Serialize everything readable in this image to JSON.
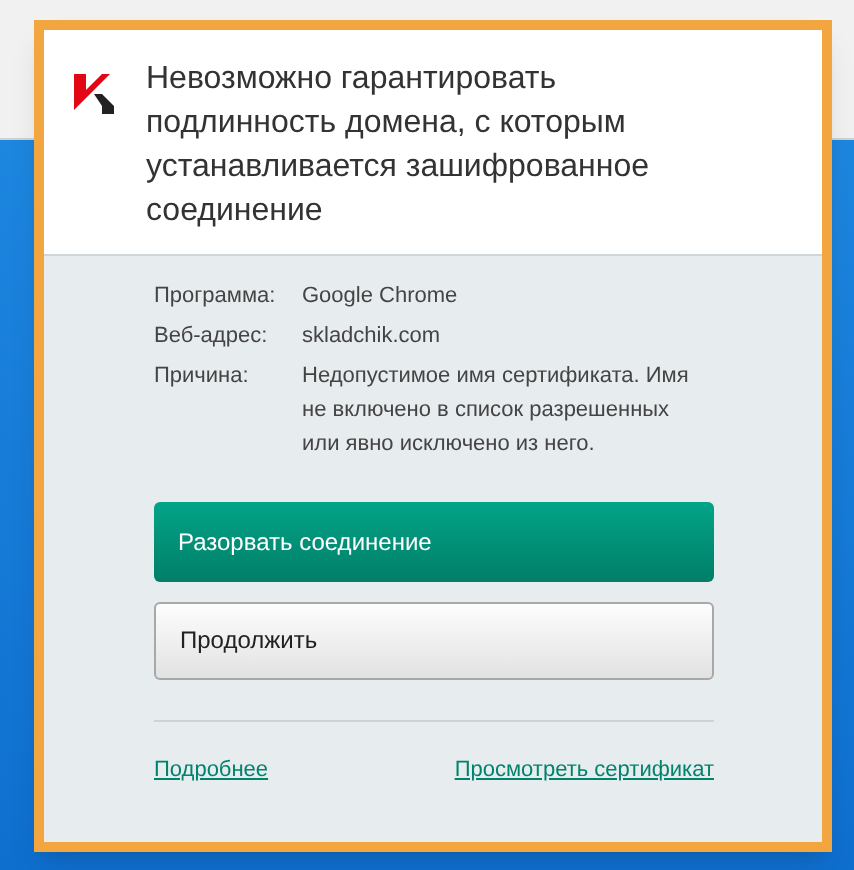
{
  "dialog": {
    "title": "Невозможно гарантировать подлинность домена, с которым устанавливается зашифрованное соединение",
    "details": [
      {
        "label": "Программа:",
        "value": "Google Chrome"
      },
      {
        "label": "Веб-адрес:",
        "value": "skladchik.com"
      },
      {
        "label": "Причина:",
        "value": "Недопустимое имя сертификата. Имя не включено в список разрешенных или явно исключено из него."
      }
    ],
    "buttons": [
      {
        "label": "Разорвать соединение",
        "kind": "primary"
      },
      {
        "label": "Продолжить",
        "kind": "secondary"
      }
    ],
    "links": [
      "Подробнее",
      "Просмотреть сертификат"
    ]
  }
}
